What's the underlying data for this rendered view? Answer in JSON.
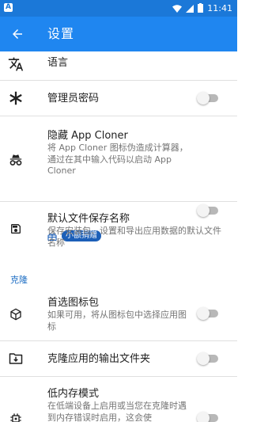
{
  "status_bar": {
    "app_indicator": "A",
    "time": "11:41",
    "icons": [
      "wifi-icon",
      "signal-icon",
      "battery-icon"
    ]
  },
  "toolbar": {
    "title": "设置"
  },
  "items": [
    {
      "id": "language",
      "icon": "translate-icon",
      "title": "语言",
      "summary": ""
    },
    {
      "id": "admin-password",
      "icon": "asterisk-icon",
      "title": "管理员密码",
      "summary": "",
      "toggle": false
    },
    {
      "id": "hide-app-cloner",
      "icon": "incognito-icon",
      "title": "隐藏 App Cloner",
      "summary": "将 App Cloner 图标伪造成计算器，通过在其中输入代码以启动 App Cloner",
      "toggle": false,
      "badge": "小额捐赠"
    },
    {
      "id": "default-save-name",
      "icon": "save-icon",
      "title": "默认文件保存名称",
      "summary": "保存安装包、设置和导出应用数据的默认文件名称"
    },
    {
      "id": "preferred-icon-pack",
      "icon": "cube-icon",
      "title": "首选图标包",
      "summary": "如果可用，将从图标包中选择应用图标",
      "toggle": false
    },
    {
      "id": "clone-output-folder",
      "icon": "folder-download-icon",
      "title": "克隆应用的输出文件夹",
      "summary": "",
      "toggle": false
    },
    {
      "id": "low-memory-mode",
      "icon": "chip-icon",
      "title": "低内存模式",
      "summary": "在低端设备上启用或当您在克隆时遇到内存错误时启用，这会使",
      "toggle": false
    }
  ],
  "sections": {
    "clone": "克隆"
  },
  "colors": {
    "toolbar": "#1f86f0",
    "status_bar": "#1b78d8",
    "accent": "#1f6fc4",
    "badge": "#1c5fb8"
  }
}
